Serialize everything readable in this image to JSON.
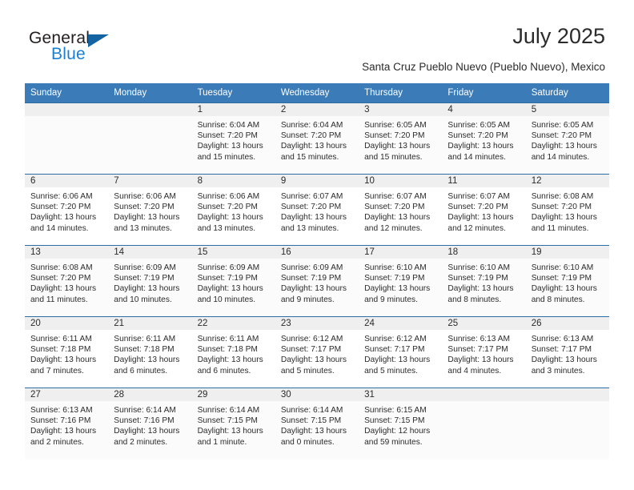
{
  "brand": {
    "name_part1": "General",
    "name_part2": "Blue",
    "logo_icon": "triangle-icon",
    "accent_color": "#1463a3",
    "blue_text_color": "#1a7fd4"
  },
  "header": {
    "title": "July 2025",
    "subtitle": "Santa Cruz Pueblo Nuevo (Pueblo Nuevo), Mexico"
  },
  "theme": {
    "header_row_bg": "#3b7cb8",
    "header_row_text": "#ffffff",
    "row_divider": "#2e6da4",
    "daynum_band_bg": "#efeff0",
    "shaded_row_bg": "#fbfbfb"
  },
  "calendar": {
    "weekdays": [
      "Sunday",
      "Monday",
      "Tuesday",
      "Wednesday",
      "Thursday",
      "Friday",
      "Saturday"
    ],
    "weeks": [
      [
        {
          "day": "",
          "detail": ""
        },
        {
          "day": "",
          "detail": ""
        },
        {
          "day": "1",
          "detail": "Sunrise: 6:04 AM\nSunset: 7:20 PM\nDaylight: 13 hours\nand 15 minutes."
        },
        {
          "day": "2",
          "detail": "Sunrise: 6:04 AM\nSunset: 7:20 PM\nDaylight: 13 hours\nand 15 minutes."
        },
        {
          "day": "3",
          "detail": "Sunrise: 6:05 AM\nSunset: 7:20 PM\nDaylight: 13 hours\nand 15 minutes."
        },
        {
          "day": "4",
          "detail": "Sunrise: 6:05 AM\nSunset: 7:20 PM\nDaylight: 13 hours\nand 14 minutes."
        },
        {
          "day": "5",
          "detail": "Sunrise: 6:05 AM\nSunset: 7:20 PM\nDaylight: 13 hours\nand 14 minutes."
        }
      ],
      [
        {
          "day": "6",
          "detail": "Sunrise: 6:06 AM\nSunset: 7:20 PM\nDaylight: 13 hours\nand 14 minutes."
        },
        {
          "day": "7",
          "detail": "Sunrise: 6:06 AM\nSunset: 7:20 PM\nDaylight: 13 hours\nand 13 minutes."
        },
        {
          "day": "8",
          "detail": "Sunrise: 6:06 AM\nSunset: 7:20 PM\nDaylight: 13 hours\nand 13 minutes."
        },
        {
          "day": "9",
          "detail": "Sunrise: 6:07 AM\nSunset: 7:20 PM\nDaylight: 13 hours\nand 13 minutes."
        },
        {
          "day": "10",
          "detail": "Sunrise: 6:07 AM\nSunset: 7:20 PM\nDaylight: 13 hours\nand 12 minutes."
        },
        {
          "day": "11",
          "detail": "Sunrise: 6:07 AM\nSunset: 7:20 PM\nDaylight: 13 hours\nand 12 minutes."
        },
        {
          "day": "12",
          "detail": "Sunrise: 6:08 AM\nSunset: 7:20 PM\nDaylight: 13 hours\nand 11 minutes."
        }
      ],
      [
        {
          "day": "13",
          "detail": "Sunrise: 6:08 AM\nSunset: 7:20 PM\nDaylight: 13 hours\nand 11 minutes."
        },
        {
          "day": "14",
          "detail": "Sunrise: 6:09 AM\nSunset: 7:19 PM\nDaylight: 13 hours\nand 10 minutes."
        },
        {
          "day": "15",
          "detail": "Sunrise: 6:09 AM\nSunset: 7:19 PM\nDaylight: 13 hours\nand 10 minutes."
        },
        {
          "day": "16",
          "detail": "Sunrise: 6:09 AM\nSunset: 7:19 PM\nDaylight: 13 hours\nand 9 minutes."
        },
        {
          "day": "17",
          "detail": "Sunrise: 6:10 AM\nSunset: 7:19 PM\nDaylight: 13 hours\nand 9 minutes."
        },
        {
          "day": "18",
          "detail": "Sunrise: 6:10 AM\nSunset: 7:19 PM\nDaylight: 13 hours\nand 8 minutes."
        },
        {
          "day": "19",
          "detail": "Sunrise: 6:10 AM\nSunset: 7:19 PM\nDaylight: 13 hours\nand 8 minutes."
        }
      ],
      [
        {
          "day": "20",
          "detail": "Sunrise: 6:11 AM\nSunset: 7:18 PM\nDaylight: 13 hours\nand 7 minutes."
        },
        {
          "day": "21",
          "detail": "Sunrise: 6:11 AM\nSunset: 7:18 PM\nDaylight: 13 hours\nand 6 minutes."
        },
        {
          "day": "22",
          "detail": "Sunrise: 6:11 AM\nSunset: 7:18 PM\nDaylight: 13 hours\nand 6 minutes."
        },
        {
          "day": "23",
          "detail": "Sunrise: 6:12 AM\nSunset: 7:17 PM\nDaylight: 13 hours\nand 5 minutes."
        },
        {
          "day": "24",
          "detail": "Sunrise: 6:12 AM\nSunset: 7:17 PM\nDaylight: 13 hours\nand 5 minutes."
        },
        {
          "day": "25",
          "detail": "Sunrise: 6:13 AM\nSunset: 7:17 PM\nDaylight: 13 hours\nand 4 minutes."
        },
        {
          "day": "26",
          "detail": "Sunrise: 6:13 AM\nSunset: 7:17 PM\nDaylight: 13 hours\nand 3 minutes."
        }
      ],
      [
        {
          "day": "27",
          "detail": "Sunrise: 6:13 AM\nSunset: 7:16 PM\nDaylight: 13 hours\nand 2 minutes."
        },
        {
          "day": "28",
          "detail": "Sunrise: 6:14 AM\nSunset: 7:16 PM\nDaylight: 13 hours\nand 2 minutes."
        },
        {
          "day": "29",
          "detail": "Sunrise: 6:14 AM\nSunset: 7:15 PM\nDaylight: 13 hours\nand 1 minute."
        },
        {
          "day": "30",
          "detail": "Sunrise: 6:14 AM\nSunset: 7:15 PM\nDaylight: 13 hours\nand 0 minutes."
        },
        {
          "day": "31",
          "detail": "Sunrise: 6:15 AM\nSunset: 7:15 PM\nDaylight: 12 hours\nand 59 minutes."
        },
        {
          "day": "",
          "detail": ""
        },
        {
          "day": "",
          "detail": ""
        }
      ]
    ]
  }
}
